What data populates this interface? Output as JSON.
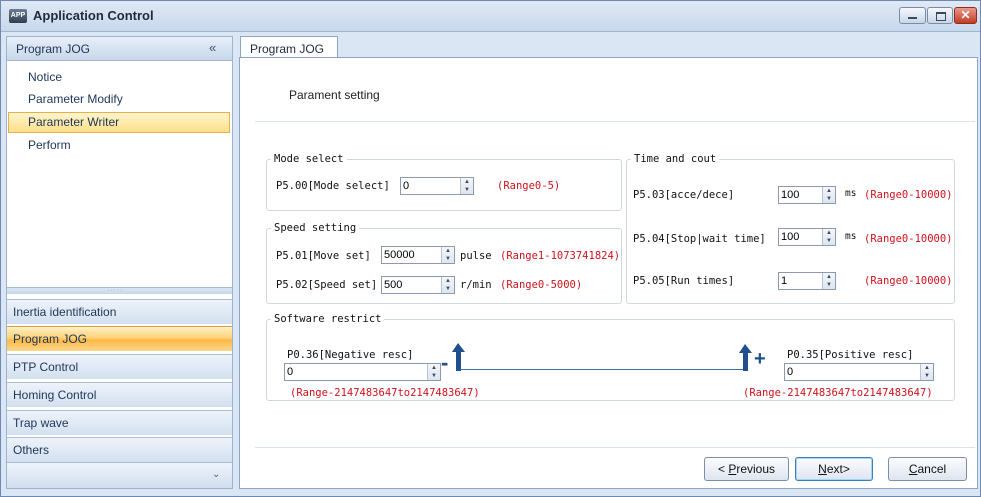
{
  "window": {
    "title": "Application Control",
    "icon": "app-icon"
  },
  "sidebar": {
    "header": "Program JOG",
    "collapse_glyph": "«",
    "items": [
      {
        "label": "Notice"
      },
      {
        "label": "Parameter Modify"
      },
      {
        "label": "Parameter Writer",
        "selected": true
      },
      {
        "label": "Perform"
      }
    ],
    "groups": [
      {
        "label": "Inertia identification"
      },
      {
        "label": "Program JOG",
        "active": true
      },
      {
        "label": "PTP Control"
      },
      {
        "label": "Homing Control"
      },
      {
        "label": "Trap wave"
      },
      {
        "label": "Others"
      }
    ]
  },
  "tab": {
    "label": "Program JOG"
  },
  "main": {
    "heading": "Parament setting",
    "mode_select": {
      "legend": "Mode select",
      "label": "P5.00[Mode select]",
      "value": "0",
      "range": "(Range0-5)"
    },
    "speed_setting": {
      "legend": "Speed setting",
      "move": {
        "label": "P5.01[Move set]",
        "value": "50000",
        "unit": "pulse",
        "range": "(Range1-1073741824)"
      },
      "speed": {
        "label": "P5.02[Speed set]",
        "value": "500",
        "unit": "r/min",
        "range": "(Range0-5000)"
      }
    },
    "time_count": {
      "legend": "Time and cout",
      "acce": {
        "label": "P5.03[acce/dece]",
        "value": "100",
        "unit": "ms",
        "range": "(Range0-10000)"
      },
      "stop": {
        "label": "P5.04[Stop|wait time]",
        "value": "100",
        "unit": "ms",
        "range": "(Range0-10000)"
      },
      "runs": {
        "label": "P5.05[Run times]",
        "value": "1",
        "range": "(Range0-10000)"
      }
    },
    "software_restrict": {
      "legend": "Software restrict",
      "negative": {
        "label": "P0.36[Negative resc]",
        "value": "0",
        "range": "(Range-2147483647to2147483647)",
        "sign": "-"
      },
      "positive": {
        "label": "P0.35[Positive resc]",
        "value": "0",
        "range": "(Range-2147483647to2147483647)",
        "sign": "+"
      }
    }
  },
  "buttons": {
    "previous_prefix": "< ",
    "previous_mnemonic": "P",
    "previous_rest": "revious",
    "next_mnemonic": "N",
    "next_rest": "ext>",
    "cancel_mnemonic": "C",
    "cancel_rest": "ancel"
  },
  "colors": {
    "range_text": "#d2121c",
    "selection": "#ffd37a",
    "accent": "#1f4f8f"
  }
}
